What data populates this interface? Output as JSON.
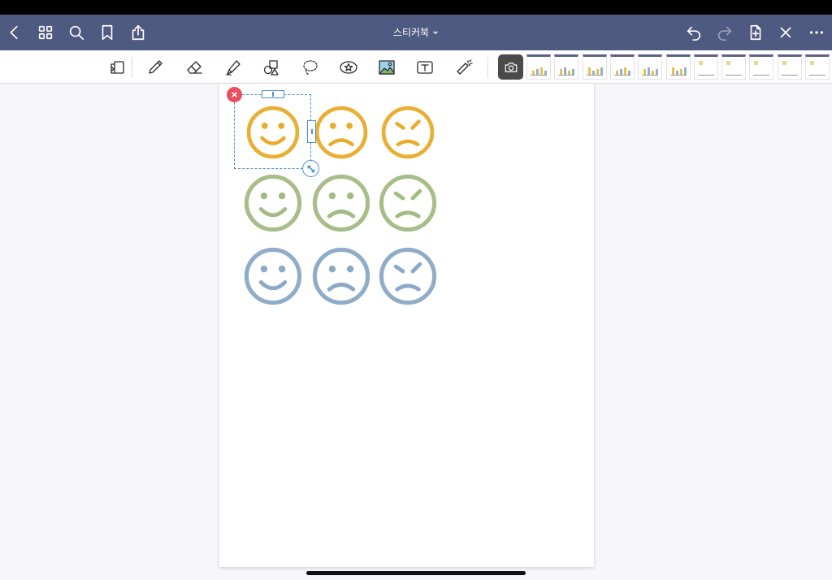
{
  "document": {
    "title": "스티커북"
  },
  "colors": {
    "nav_bar": "#4f5a80",
    "yellow": "#e8ac2a",
    "green": "#a4bb84",
    "blue": "#8aa9c6",
    "delete": "#e94f5e",
    "selection": "#4a8fd6"
  },
  "nav": {
    "left": [
      {
        "icon": "back-chevron-icon"
      },
      {
        "icon": "grid-icon"
      },
      {
        "icon": "search-icon"
      },
      {
        "icon": "bookmark-icon"
      },
      {
        "icon": "share-icon"
      }
    ],
    "right": [
      {
        "icon": "undo-icon"
      },
      {
        "icon": "redo-icon",
        "disabled": true
      },
      {
        "icon": "add-page-icon"
      },
      {
        "icon": "close-icon"
      },
      {
        "icon": "more-icon"
      }
    ]
  },
  "toolbar": {
    "tools": [
      "page-switch-icon",
      "pen-icon",
      "eraser-icon",
      "highlighter-icon",
      "shapes-icon",
      "lasso-icon",
      "sticker-icon",
      "image-icon",
      "text-icon",
      "laser-pointer-icon"
    ],
    "camera": "camera-icon",
    "thumbnail_count": 11
  },
  "stickers": [
    {
      "mood": "happy",
      "color": "yellow"
    },
    {
      "mood": "sad",
      "color": "yellow"
    },
    {
      "mood": "angry",
      "color": "yellow"
    },
    {
      "mood": "happy",
      "color": "green"
    },
    {
      "mood": "sad",
      "color": "green"
    },
    {
      "mood": "angry",
      "color": "green"
    },
    {
      "mood": "happy",
      "color": "blue"
    },
    {
      "mood": "sad",
      "color": "blue"
    },
    {
      "mood": "angry",
      "color": "blue"
    }
  ],
  "selection": {
    "selected_sticker": 1
  }
}
